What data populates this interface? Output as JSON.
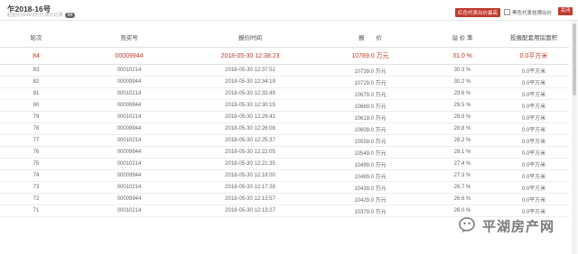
{
  "header": {
    "lot_title": "乍2018-16号",
    "lot_subtitle": "起始价9239.0万元 出价记录",
    "record_count": "84",
    "legend_label": "红色代表出价最高",
    "legend_checkbox_label": "黑色代表挂牌出价",
    "close_label": "关闭"
  },
  "table": {
    "columns": [
      "轮次",
      "竞买号",
      "报价时间",
      "报　　价",
      "溢 价 率",
      "投报配套用房面积"
    ],
    "rows": [
      {
        "round": "84",
        "bidder": "00009944",
        "time": "2018-05-30 12:38:23",
        "price": "10789.0 万元",
        "premium": "31.0 %",
        "area": "0.0平方米",
        "highlight": true
      },
      {
        "round": "83",
        "bidder": "00010214",
        "time": "2018-05-30 12:37:52",
        "price": "10739.0 万元",
        "premium": "30.3 %",
        "area": "0.0平方米"
      },
      {
        "round": "82",
        "bidder": "00009944",
        "time": "2018-05-30 12:34:19",
        "price": "10729.0 万元",
        "premium": "30.2 %",
        "area": "0.0平方米"
      },
      {
        "round": "81",
        "bidder": "00010214",
        "time": "2018-05-30 12:33:49",
        "price": "10679.0 万元",
        "premium": "29.6 %",
        "area": "0.0平方米"
      },
      {
        "round": "80",
        "bidder": "00009944",
        "time": "2018-05-30 12:30:15",
        "price": "10669.0 万元",
        "premium": "29.5 %",
        "area": "0.0平方米"
      },
      {
        "round": "79",
        "bidder": "00010214",
        "time": "2018-05-30 12:29:41",
        "price": "10619.0 万元",
        "premium": "28.9 %",
        "area": "0.0平方米"
      },
      {
        "round": "78",
        "bidder": "00009944",
        "time": "2018-05-30 12:26:08",
        "price": "10609.0 万元",
        "premium": "28.8 %",
        "area": "0.0平方米"
      },
      {
        "round": "77",
        "bidder": "00010214",
        "time": "2018-05-30 12:25:37",
        "price": "10559.0 万元",
        "premium": "28.2 %",
        "area": "0.0平方米"
      },
      {
        "round": "76",
        "bidder": "00009944",
        "time": "2018-05-30 12:22:05",
        "price": "10549.0 万元",
        "premium": "28.1 %",
        "area": "0.0平方米"
      },
      {
        "round": "75",
        "bidder": "00010214",
        "time": "2018-05-30 12:21:35",
        "price": "10499.0 万元",
        "premium": "27.4 %",
        "area": "0.0平方米"
      },
      {
        "round": "74",
        "bidder": "00009944",
        "time": "2018-05-30 12:18:00",
        "price": "10489.0 万元",
        "premium": "27.3 %",
        "area": "0.0平方米"
      },
      {
        "round": "73",
        "bidder": "00010214",
        "time": "2018-05-30 12:17:28",
        "price": "10439.0 万元",
        "premium": "26.7 %",
        "area": "0.0平方米"
      },
      {
        "round": "72",
        "bidder": "00009944",
        "time": "2018-05-30 12:13:57",
        "price": "10429.0 万元",
        "premium": "26.6 %",
        "area": "0.0平方米"
      },
      {
        "round": "71",
        "bidder": "00010214",
        "time": "2018-05-30 12:13:27",
        "price": "10379.0 万元",
        "premium": "26.0 %",
        "area": "0.0平方米"
      }
    ]
  },
  "watermark": {
    "text": "平湖房产网",
    "icon": "wechat-icon"
  },
  "colors": {
    "highlight": "#c0392b",
    "text": "#666666"
  }
}
